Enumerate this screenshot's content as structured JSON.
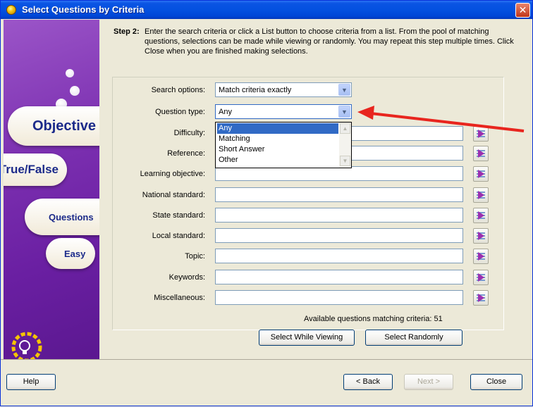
{
  "window": {
    "title": "Select Questions by Criteria",
    "close_glyph": "✕"
  },
  "sidebar": {
    "pills": [
      "Objective",
      "True/False",
      "Questions",
      "Easy"
    ],
    "logo_icon": "lightbulb-icon"
  },
  "step": {
    "label": "Step 2:",
    "text": "Enter the search criteria or click a List button to choose criteria from a list. From the pool of matching questions, selections can be made while viewing or randomly. You may repeat this step multiple times. Click Close when you are finished making selections."
  },
  "form": {
    "search_options": {
      "label": "Search options:",
      "value": "Match criteria exactly"
    },
    "question_type": {
      "label": "Question type:",
      "value": "Any",
      "options": [
        "Any",
        "Matching",
        "Short Answer",
        "Other"
      ]
    },
    "fields": [
      {
        "label": "Difficulty:",
        "value": ""
      },
      {
        "label": "Reference:",
        "value": ""
      },
      {
        "label": "Learning objective:",
        "value": ""
      },
      {
        "label": "National standard:",
        "value": ""
      },
      {
        "label": "State standard:",
        "value": ""
      },
      {
        "label": "Local standard:",
        "value": ""
      },
      {
        "label": "Topic:",
        "value": ""
      },
      {
        "label": "Keywords:",
        "value": ""
      },
      {
        "label": "Miscellaneous:",
        "value": ""
      }
    ],
    "count_text": "Available questions matching criteria: 51"
  },
  "actions": {
    "select_viewing": "Select While Viewing",
    "select_randomly": "Select Randomly"
  },
  "footer": {
    "help": "Help",
    "back": "< Back",
    "next": "Next >",
    "close": "Close"
  },
  "colors": {
    "accent_blue": "#0451e0",
    "sidebar_purple": "#7b2fb0",
    "selection": "#316ac5",
    "annotation_arrow": "#e8251e"
  }
}
